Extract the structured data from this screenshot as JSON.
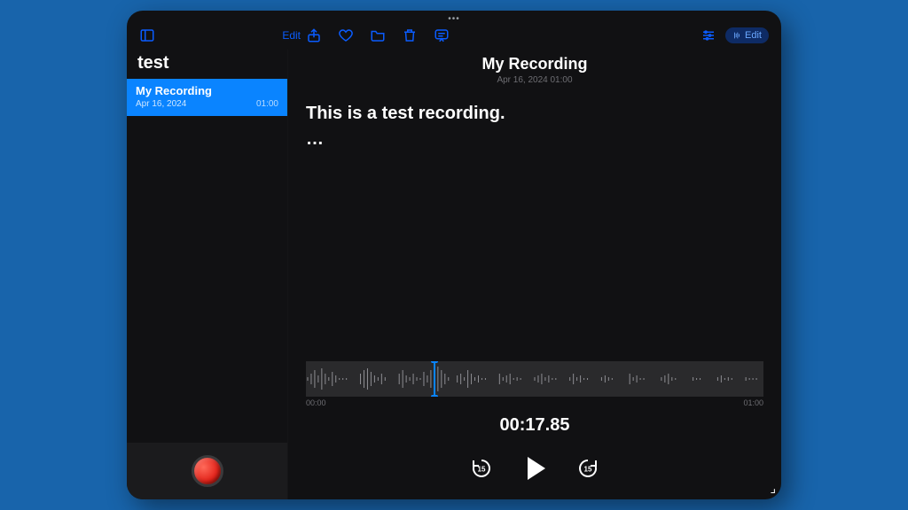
{
  "toolbar": {
    "edit_left": "Edit",
    "edit_right": "Edit"
  },
  "sidebar": {
    "title": "test",
    "items": [
      {
        "title": "My Recording",
        "date": "Apr 16, 2024",
        "length": "01:00"
      }
    ]
  },
  "main": {
    "title": "My Recording",
    "subtitle": "Apr 16, 2024  01:00",
    "transcript": "This is a test recording.",
    "ellipsis": "…",
    "waveform": {
      "start_label": "00:00",
      "end_label": "01:00"
    },
    "current_time": "00:17.85",
    "skip_seconds": "15",
    "colors": {
      "accent": "#0a84ff",
      "record": "#e2231a"
    }
  }
}
